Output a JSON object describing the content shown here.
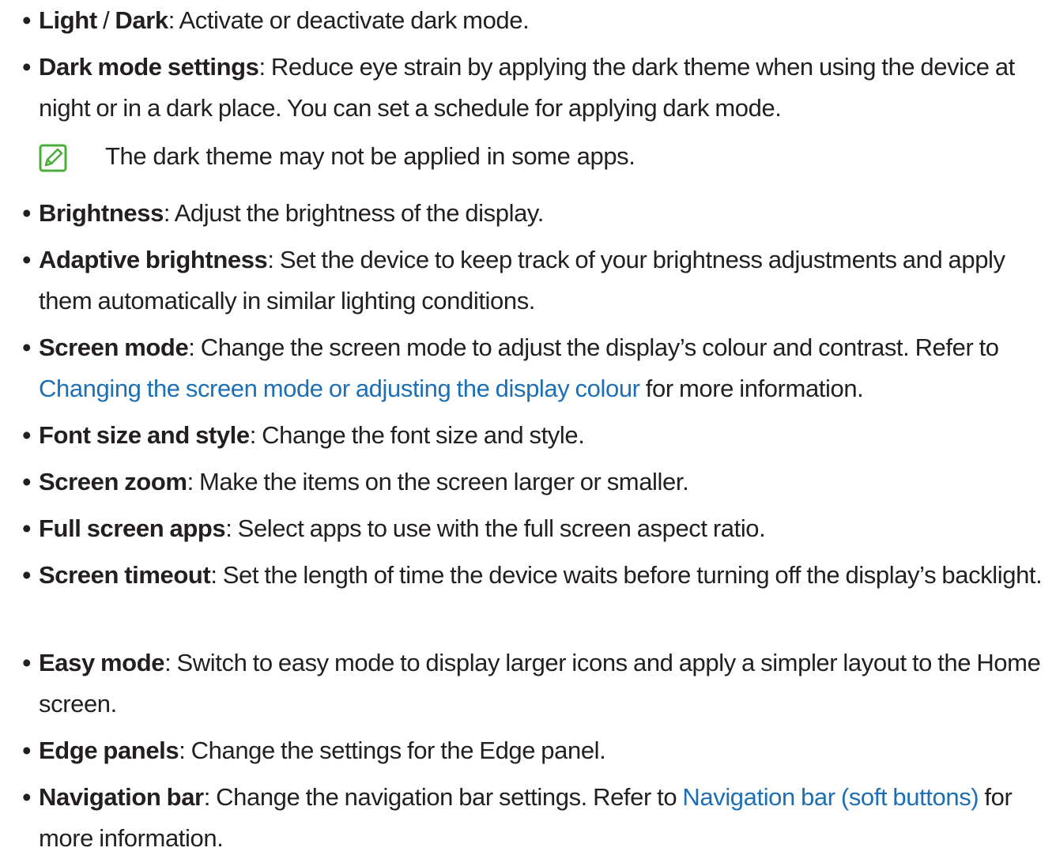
{
  "bullet_glyph": "•",
  "items": [
    {
      "term": "Light",
      "sep": " / ",
      "term2": "Dark",
      "desc": ": Activate or deactivate dark mode."
    },
    {
      "term": "Dark mode settings",
      "desc": ": Reduce eye strain by applying the dark theme when using the device at night or in a dark place. You can set a schedule for applying dark mode."
    },
    {
      "term": "Brightness",
      "desc": ": Adjust the brightness of the display."
    },
    {
      "term": "Adaptive brightness",
      "desc": ": Set the device to keep track of your brightness adjustments and apply them automatically in similar lighting conditions."
    },
    {
      "term": "Screen mode",
      "desc": ": Change the screen mode to adjust the display’s colour and contrast. Refer to ",
      "link": "Changing the screen mode or adjusting the display colour",
      "after": " for more information."
    },
    {
      "term": "Font size and style",
      "desc": ": Change the font size and style."
    },
    {
      "term": "Screen zoom",
      "desc": ": Make the items on the screen larger or smaller."
    },
    {
      "term": "Full screen apps",
      "desc": ": Select apps to use with the full screen aspect ratio."
    },
    {
      "term": "Screen timeout",
      "desc": ": Set the length of time the device waits before turning off the display’s backlight."
    },
    {
      "term": "Easy mode",
      "desc": ": Switch to easy mode to display larger icons and apply a simpler layout to the Home screen."
    },
    {
      "term": "Edge panels",
      "desc": ": Change the settings for the Edge panel."
    },
    {
      "term": "Navigation bar",
      "desc": ": Change the navigation bar settings. Refer to ",
      "link": "Navigation bar (soft buttons)",
      "after": " for more information."
    }
  ],
  "note": {
    "icon": "note-pencil-icon",
    "text": "The dark theme may not be applied in some apps."
  },
  "colors": {
    "text": "#231f20",
    "link": "#1c6fb5",
    "note_icon": "#4cae3a"
  }
}
